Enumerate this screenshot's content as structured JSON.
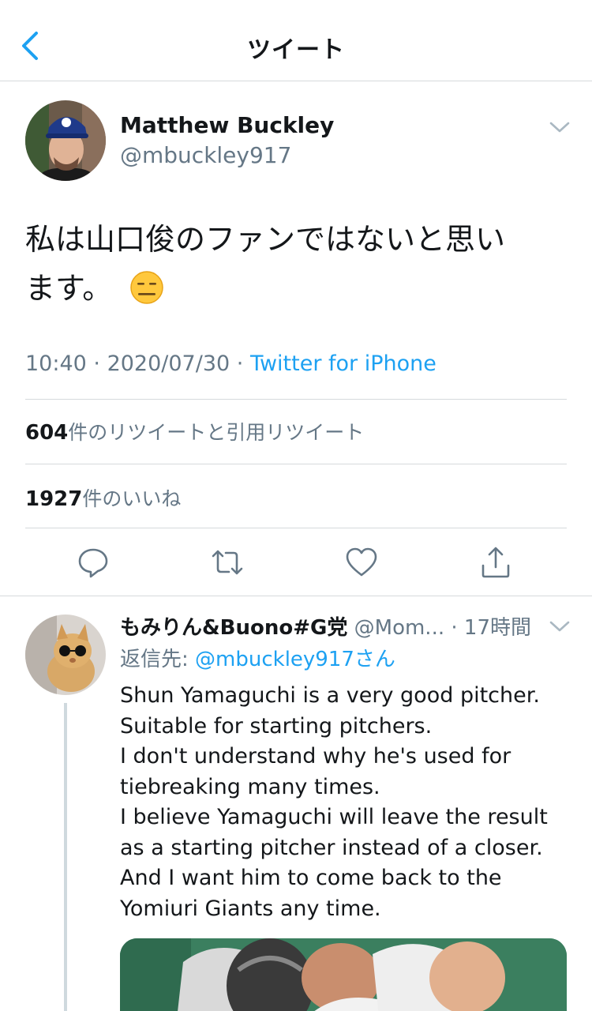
{
  "header": {
    "title": "ツイート",
    "back_icon": "chevron-left-icon"
  },
  "tweet": {
    "author_name": "Matthew Buckley",
    "author_handle": "@mbuckley917",
    "text_line1": "私は山口俊のファンではないと思い",
    "text_line2": "ます。",
    "emoji": "expressionless-face-emoji",
    "time": "10:40",
    "date": "2020/07/30",
    "source": "Twitter for iPhone",
    "retweets_count": "604",
    "retweets_label": "件のリツイートと引用リツイート",
    "likes_count": "1927",
    "likes_label": "件のいいね"
  },
  "actions": [
    "reply-icon",
    "retweet-icon",
    "like-icon",
    "share-icon"
  ],
  "reply": {
    "author_name": "もみりん&Buono#G党",
    "author_handle": "@Mom...",
    "time": "17時間",
    "reply_to_label": "返信先:",
    "reply_to_mention": "@mbuckley917さん",
    "lines": [
      "Shun Yamaguchi is a very good pitcher.",
      "Suitable for starting pitchers.",
      "I don't understand why he's used for",
      "tiebreaking many times.",
      "I believe Yamaguchi will leave the result",
      "as a starting pitcher instead of a closer.",
      "And I want him to come back to the",
      "Yomiuri Giants any time."
    ]
  },
  "colors": {
    "accent": "#1da1f2",
    "secondary_text": "#657786",
    "divider": "#d6d9dc"
  }
}
